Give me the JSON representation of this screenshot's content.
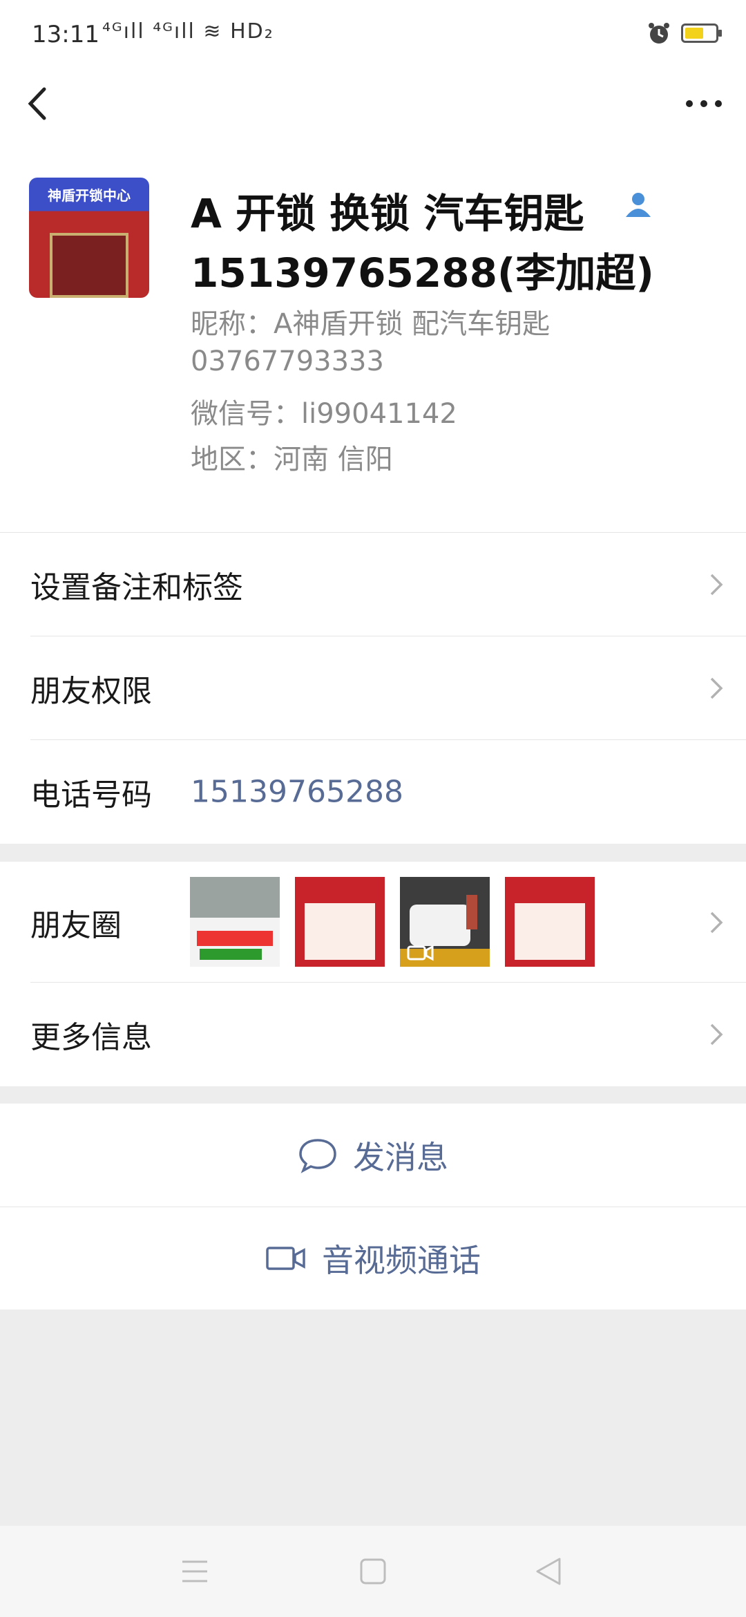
{
  "status_bar": {
    "time": "13:11",
    "signal_text": "⁴ᴳıll ⁴ᴳıll ≋ HD₂"
  },
  "header": {
    "back_icon": "chevron-left-icon",
    "more_icon": "ellipsis-icon"
  },
  "profile": {
    "name_line1": "A 开锁 换锁 汽车钥匙",
    "name_line2": "15139765288(李加超)",
    "nickname": "昵称：A神盾开锁 配汽车钥匙",
    "nickname_line2": "03767793333",
    "wechat_id": "微信号：li99041142",
    "region": "地区：河南  信阳",
    "avatar_sign_text": "神盾开锁中心"
  },
  "rows": {
    "remark": {
      "label": "设置备注和标签"
    },
    "permissions": {
      "label": "朋友权限"
    },
    "phone": {
      "label": "电话号码",
      "value": "15139765288"
    },
    "moments": {
      "label": "朋友圈"
    },
    "more_info": {
      "label": "更多信息"
    }
  },
  "actions": {
    "message": {
      "label": "发消息",
      "icon": "chat-bubble-icon"
    },
    "call": {
      "label": "音视频通话",
      "icon": "video-camera-icon"
    }
  },
  "colors": {
    "link": "#576b95",
    "accent_icon": "#4a90d9",
    "battery": "#f3d21c"
  }
}
